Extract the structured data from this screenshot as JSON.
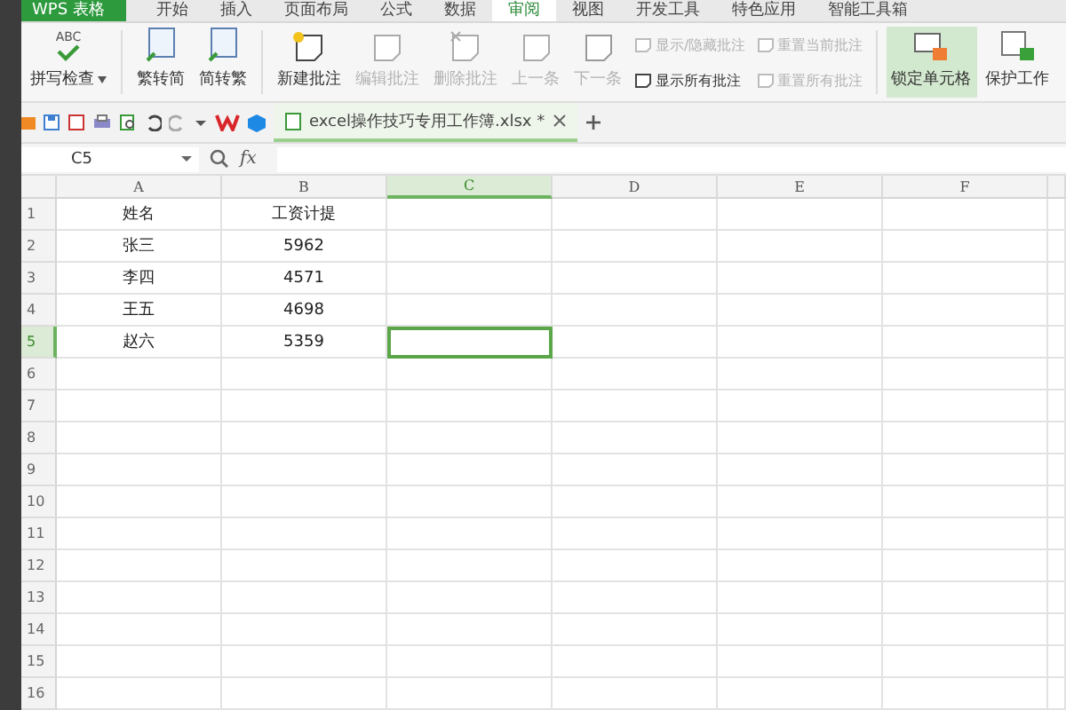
{
  "app_button": "WPS 表格",
  "menu_tabs": [
    {
      "label": "开始",
      "selected": false
    },
    {
      "label": "插入",
      "selected": false
    },
    {
      "label": "页面布局",
      "selected": false
    },
    {
      "label": "公式",
      "selected": false
    },
    {
      "label": "数据",
      "selected": false
    },
    {
      "label": "审阅",
      "selected": true
    },
    {
      "label": "视图",
      "selected": false
    },
    {
      "label": "开发工具",
      "selected": false
    },
    {
      "label": "特色应用",
      "selected": false
    },
    {
      "label": "智能工具箱",
      "selected": false
    }
  ],
  "ribbon": [
    {
      "kind": "large",
      "icon_text": "ABC",
      "label": "拼写检查",
      "dropdown": true,
      "disabled": false,
      "highlighted": false
    },
    {
      "kind": "separator"
    },
    {
      "kind": "large",
      "label": "繁转简",
      "dropdown": false,
      "disabled": false,
      "highlighted": false
    },
    {
      "kind": "large",
      "label": "简转繁",
      "dropdown": false,
      "disabled": false,
      "highlighted": false
    },
    {
      "kind": "separator"
    },
    {
      "kind": "large",
      "label": "新建批注",
      "dropdown": false,
      "disabled": false,
      "highlighted": false
    },
    {
      "kind": "large",
      "label": "编辑批注",
      "dropdown": false,
      "disabled": true,
      "highlighted": false
    },
    {
      "kind": "large",
      "label": "删除批注",
      "dropdown": false,
      "disabled": true,
      "highlighted": false
    },
    {
      "kind": "large",
      "label": "上一条",
      "dropdown": false,
      "disabled": true,
      "highlighted": false
    },
    {
      "kind": "large",
      "label": "下一条",
      "dropdown": false,
      "disabled": true,
      "highlighted": false
    },
    {
      "kind": "pair",
      "items": [
        {
          "label": "显示/隐藏批注",
          "disabled": true
        },
        {
          "label": "显示所有批注",
          "disabled": false
        }
      ]
    },
    {
      "kind": "pair",
      "items": [
        {
          "label": "重置当前批注",
          "disabled": true
        },
        {
          "label": "重置所有批注",
          "disabled": true
        }
      ]
    },
    {
      "kind": "separator"
    },
    {
      "kind": "large",
      "label": "锁定单元格",
      "dropdown": false,
      "disabled": false,
      "highlighted": true
    },
    {
      "kind": "large",
      "label": "保护工作",
      "dropdown": false,
      "disabled": false,
      "highlighted": false
    }
  ],
  "doc_tab": {
    "title": "excel操作技巧专用工作簿.xlsx *",
    "selected": true
  },
  "name_box": "C5",
  "fx": "fx",
  "columns": [
    {
      "label": "A",
      "selected": false
    },
    {
      "label": "B",
      "selected": false
    },
    {
      "label": "C",
      "selected": true
    },
    {
      "label": "D",
      "selected": false
    },
    {
      "label": "E",
      "selected": false
    },
    {
      "label": "F",
      "selected": false
    }
  ],
  "rows": [
    {
      "number": "1",
      "selected": false,
      "cells": [
        "姓名",
        "工资计提"
      ]
    },
    {
      "number": "2",
      "selected": false,
      "cells": [
        "张三",
        "5962"
      ]
    },
    {
      "number": "3",
      "selected": false,
      "cells": [
        "李四",
        "4571"
      ]
    },
    {
      "number": "4",
      "selected": false,
      "cells": [
        "王五",
        "4698"
      ]
    },
    {
      "number": "5",
      "selected": true,
      "cells": [
        "赵六",
        "5359"
      ]
    },
    {
      "number": "6",
      "selected": false,
      "cells": []
    },
    {
      "number": "7",
      "selected": false,
      "cells": []
    },
    {
      "number": "8",
      "selected": false,
      "cells": []
    },
    {
      "number": "9",
      "selected": false,
      "cells": []
    },
    {
      "number": "10",
      "selected": false,
      "cells": []
    },
    {
      "number": "11",
      "selected": false,
      "cells": []
    },
    {
      "number": "12",
      "selected": false,
      "cells": []
    },
    {
      "number": "13",
      "selected": false,
      "cells": []
    },
    {
      "number": "14",
      "selected": false,
      "cells": []
    },
    {
      "number": "15",
      "selected": false,
      "cells": []
    },
    {
      "number": "16",
      "selected": false,
      "cells": []
    }
  ]
}
